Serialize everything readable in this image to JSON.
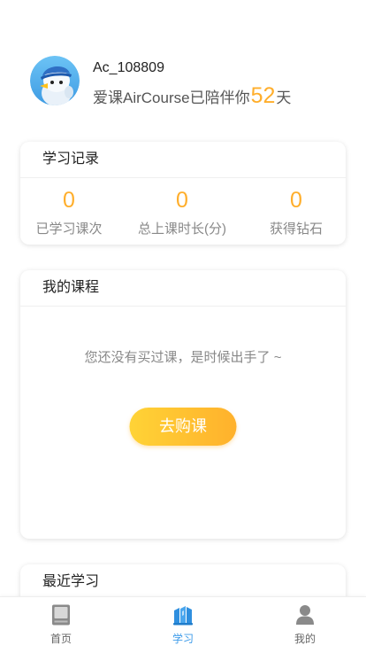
{
  "profile": {
    "username": "Ac_108809",
    "companion_prefix": "爱课AirCourse已陪伴你",
    "companion_days": "52",
    "companion_suffix": "天",
    "avatar_icon": "bird-mascot-icon"
  },
  "study_record": {
    "title": "学习记录",
    "stats": [
      {
        "value": "0",
        "label": "已学习课次"
      },
      {
        "value": "0",
        "label": "总上课时长(分)"
      },
      {
        "value": "0",
        "label": "获得钻石"
      }
    ]
  },
  "my_courses": {
    "title": "我的课程",
    "empty_text": "您还没有买过课，是时候出手了 ~",
    "buy_button": "去购课"
  },
  "recent_study": {
    "title": "最近学习"
  },
  "tab_bar": {
    "items": [
      {
        "label": "首页",
        "icon": "home-page-icon",
        "active": false
      },
      {
        "label": "学习",
        "icon": "books-icon",
        "active": true
      },
      {
        "label": "我的",
        "icon": "person-icon",
        "active": false
      }
    ]
  },
  "colors": {
    "accent_orange": "#FFAE2B",
    "active_tab": "#3D9BE9",
    "inactive_tab": "#8A8A8A",
    "button_gradient_start": "#FFD336",
    "button_gradient_end": "#FFB12C"
  }
}
